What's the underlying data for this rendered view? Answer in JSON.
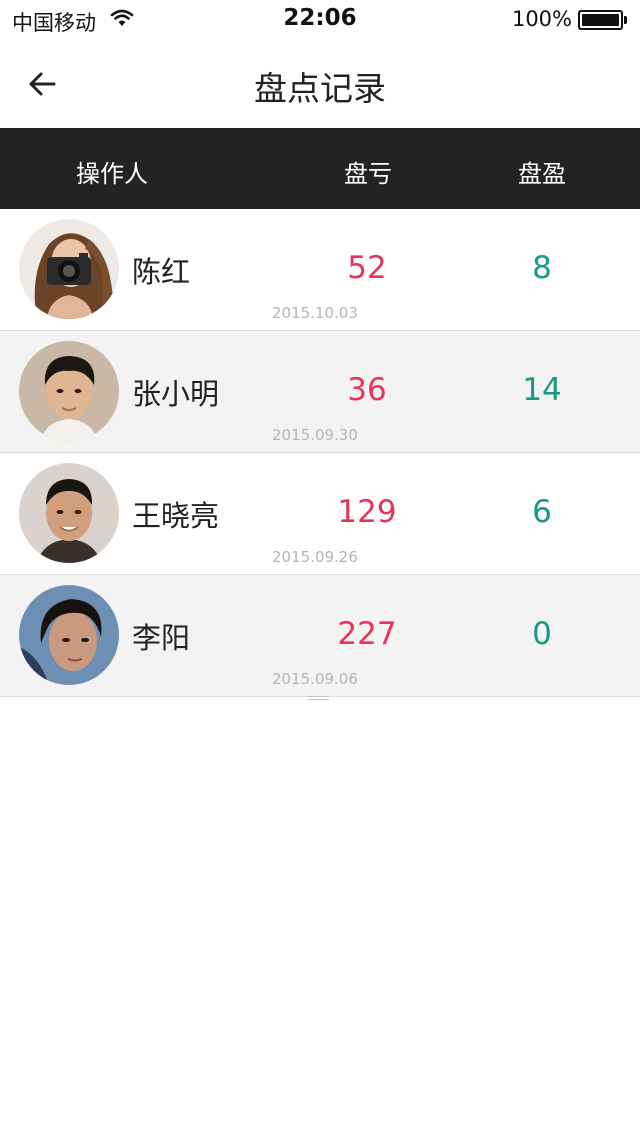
{
  "status_bar": {
    "carrier": "中国移动",
    "time": "22:06",
    "battery": "100%",
    "wifi_icon": "wifi-icon",
    "battery_icon": "battery-icon"
  },
  "nav": {
    "title": "盘点记录",
    "back_icon": "arrow-left-icon"
  },
  "table": {
    "headers": {
      "operator": "操作人",
      "loss": "盘亏",
      "gain": "盘盈"
    },
    "rows": [
      {
        "name": "陈红",
        "loss": "52",
        "gain": "8",
        "date": "2015.10.03"
      },
      {
        "name": "张小明",
        "loss": "36",
        "gain": "14",
        "date": "2015.09.30"
      },
      {
        "name": "王晓亮",
        "loss": "129",
        "gain": "6",
        "date": "2015.09.26"
      },
      {
        "name": "李阳",
        "loss": "227",
        "gain": "0",
        "date": "2015.09.06"
      }
    ]
  },
  "colors": {
    "header_bg": "#232323",
    "loss": "#e8345c",
    "gain": "#159a85",
    "row_alt_bg": "#f3f3f3"
  }
}
